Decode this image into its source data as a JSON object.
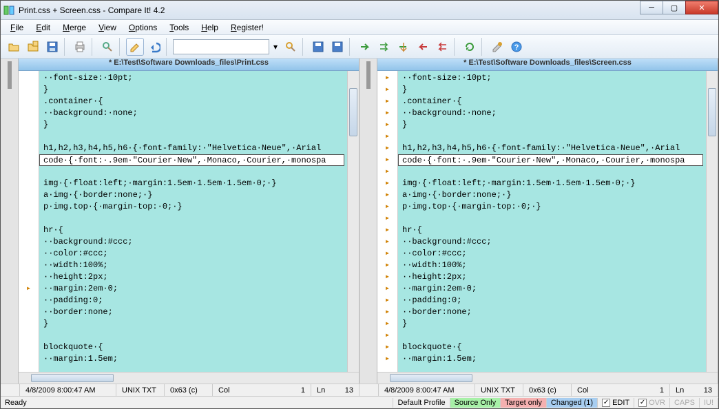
{
  "window": {
    "title": "Print.css + Screen.css - Compare It! 4.2"
  },
  "menus": [
    "File",
    "Edit",
    "Merge",
    "View",
    "Options",
    "Tools",
    "Help",
    "Register!"
  ],
  "panes": {
    "left": {
      "header": "* E:\\Test\\Software Downloads_files\\Print.css",
      "lines": [
        "··font-size:·10pt;",
        "}",
        ".container·{",
        "··background:·none;",
        "}",
        "",
        "h1,h2,h3,h4,h5,h6·{·font-family:·\"Helvetica·Neue\",·Arial",
        "code·{·font:·.9em·\"Courier·New\",·Monaco,·Courier,·monospa",
        "",
        "img·{·float:left;·margin:1.5em·1.5em·1.5em·0;·}",
        "a·img·{·border:none;·}",
        "p·img.top·{·margin-top:·0;·}",
        "",
        "hr·{",
        "··background:#ccc;",
        "··color:#ccc;",
        "··width:100%;",
        "··height:2px;",
        "··margin:2em·0;",
        "··padding:0;",
        "··border:none;",
        "}",
        "",
        "blockquote·{",
        "··margin:1.5em;"
      ],
      "highlight_index": 7
    },
    "right": {
      "header": "* E:\\Test\\Software Downloads_files\\Screen.css",
      "lines": [
        "··font-size:·10pt;",
        "}",
        ".container·{",
        "··background:·none;",
        "}",
        "",
        "h1,h2,h3,h4,h5,h6·{·font-family:·\"Helvetica·Neue\",·Arial",
        "code·{·font:·.9em·\"Courier·New\",·Monaco,·Courier,·monospa",
        "",
        "img·{·float:left;·margin:1.5em·1.5em·1.5em·0;·}",
        "a·img·{·border:none;·}",
        "p·img.top·{·margin-top:·0;·}",
        "",
        "hr·{",
        "··background:#ccc;",
        "··color:#ccc;",
        "··width:100%;",
        "··height:2px;",
        "··margin:2em·0;",
        "··padding:0;",
        "··border:none;",
        "}",
        "",
        "blockquote·{",
        "··margin:1.5em;"
      ],
      "highlight_index": 7
    }
  },
  "status1": {
    "datetime": "4/8/2009  8:00:47 AM",
    "encoding": "UNIX TXT",
    "offset": "0x63 (c)",
    "col_label": "Col",
    "col_val": "1",
    "ln_label": "Ln",
    "ln_val": "13"
  },
  "status2": {
    "ready": "Ready",
    "profile": "Default Profile",
    "source": "Source Only",
    "target": "Target only",
    "changed": "Changed (1)",
    "edit": "EDIT",
    "ovr": "OVR",
    "caps": "CAPS",
    "iu": "IU!"
  }
}
